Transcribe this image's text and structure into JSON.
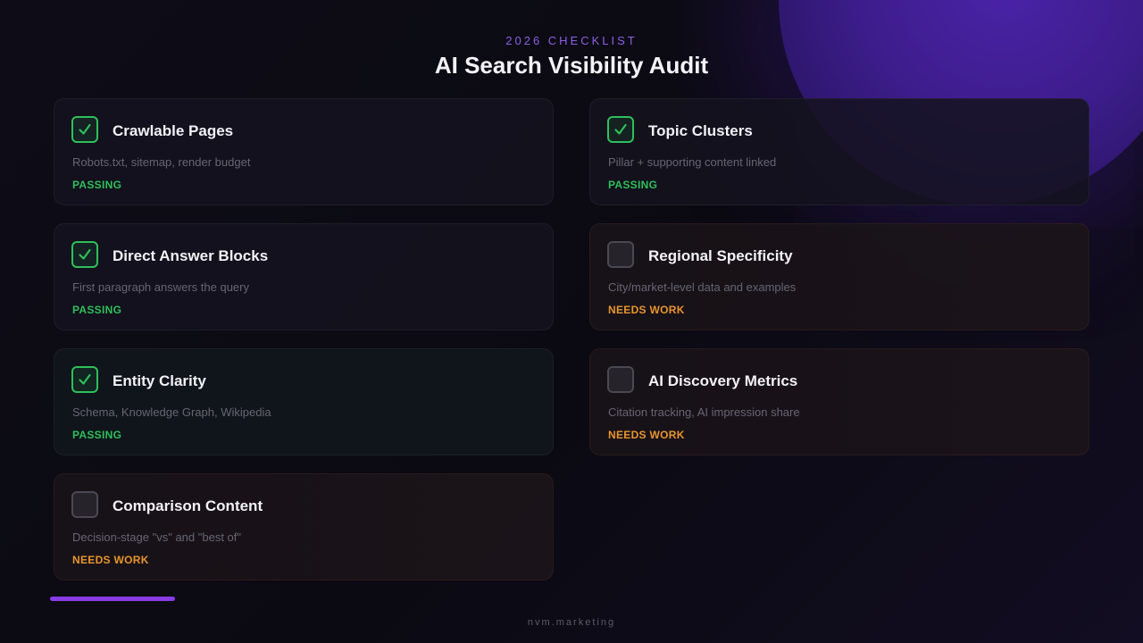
{
  "header": {
    "eyebrow": "2026 CHECKLIST",
    "title": "AI Search Visibility Audit"
  },
  "colors": {
    "accent": "#8a3ce6",
    "pass": "#2fbf5b",
    "warn": "#e8942f"
  },
  "checklist": [
    {
      "title": "Crawlable Pages",
      "description": "Robots.txt, sitemap, render budget",
      "status": "PASSING",
      "checked": true,
      "icon": "check-icon"
    },
    {
      "title": "Topic Clusters",
      "description": "Pillar + supporting content linked",
      "status": "PASSING",
      "checked": true,
      "icon": "check-icon"
    },
    {
      "title": "Direct Answer Blocks",
      "description": "First paragraph answers the query",
      "status": "PASSING",
      "checked": true,
      "icon": "check-icon"
    },
    {
      "title": "Regional Specificity",
      "description": "City/market-level data and examples",
      "status": "NEEDS WORK",
      "checked": false,
      "icon": "empty-checkbox-icon"
    },
    {
      "title": "Entity Clarity",
      "description": "Schema, Knowledge Graph, Wikipedia",
      "status": "PASSING",
      "checked": true,
      "icon": "check-icon"
    },
    {
      "title": "AI Discovery Metrics",
      "description": "Citation tracking, AI impression share",
      "status": "NEEDS WORK",
      "checked": false,
      "icon": "empty-checkbox-icon"
    },
    {
      "title": "Comparison Content",
      "description": "Decision-stage \"vs\" and \"best of\"",
      "status": "NEEDS WORK",
      "checked": false,
      "icon": "empty-checkbox-icon"
    }
  ],
  "progress": {
    "fraction": 0.25
  },
  "footer": {
    "text": "nvm.marketing"
  }
}
